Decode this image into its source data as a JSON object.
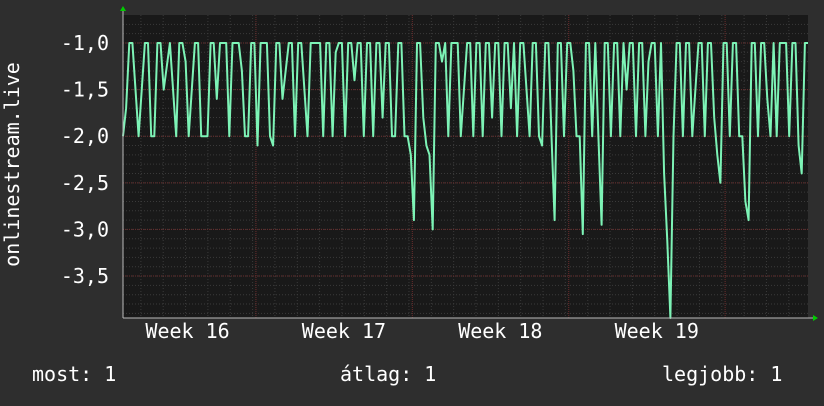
{
  "chart_data": {
    "type": "line",
    "ylabel": "onlinestream.live",
    "ylim": [
      -3.95,
      -0.7
    ],
    "y_ticks": [
      -1.0,
      -1.5,
      -2.0,
      -2.5,
      -3.0,
      -3.5
    ],
    "y_tick_labels": [
      "-1,0",
      "-1,5",
      "-2,0",
      "-2,5",
      "-3,0",
      "-3,5"
    ],
    "x_tick_labels": [
      "Week 16",
      "Week 17",
      "Week 18",
      "Week 19"
    ],
    "x_ticks_week": [
      16,
      17,
      18,
      19
    ],
    "xlim_week": [
      15.6,
      19.98
    ],
    "series": [
      {
        "color": "#7df3b6",
        "x_week": [
          15.6,
          15.62,
          15.64,
          15.66,
          15.7,
          15.74,
          15.76,
          15.78,
          15.8,
          15.82,
          15.84,
          15.86,
          15.9,
          15.94,
          15.96,
          15.98,
          16.0,
          16.02,
          16.06,
          16.08,
          16.1,
          16.14,
          16.16,
          16.18,
          16.2,
          16.22,
          16.26,
          16.28,
          16.3,
          16.34,
          16.36,
          16.38,
          16.4,
          16.42,
          16.44,
          16.46,
          16.48,
          16.5,
          16.52,
          16.54,
          16.56,
          16.58,
          16.6,
          16.62,
          16.66,
          16.68,
          16.7,
          16.72,
          16.74,
          16.78,
          16.8,
          16.82,
          16.86,
          16.88,
          16.9,
          16.92,
          16.94,
          16.96,
          16.98,
          17.0,
          17.02,
          17.04,
          17.06,
          17.08,
          17.1,
          17.12,
          17.14,
          17.16,
          17.18,
          17.2,
          17.22,
          17.24,
          17.26,
          17.28,
          17.3,
          17.32,
          17.34,
          17.36,
          17.38,
          17.4,
          17.42,
          17.44,
          17.46,
          17.48,
          17.5,
          17.52,
          17.54,
          17.56,
          17.58,
          17.6,
          17.62,
          17.64,
          17.66,
          17.68,
          17.7,
          17.72,
          17.74,
          17.76,
          17.8,
          17.82,
          17.84,
          17.86,
          17.88,
          17.9,
          17.92,
          17.94,
          17.96,
          17.98,
          18.0,
          18.02,
          18.04,
          18.06,
          18.08,
          18.1,
          18.12,
          18.14,
          18.16,
          18.18,
          18.2,
          18.22,
          18.24,
          18.26,
          18.28,
          18.3,
          18.32,
          18.34,
          18.36,
          18.38,
          18.4,
          18.42,
          18.44,
          18.46,
          18.48,
          18.5,
          18.52,
          18.54,
          18.56,
          18.58,
          18.6,
          18.62,
          18.64,
          18.66,
          18.68,
          18.7,
          18.72,
          18.74,
          18.76,
          18.78,
          18.8,
          18.82,
          18.84,
          18.86,
          18.88,
          18.9,
          18.92,
          18.94,
          18.96,
          18.98,
          19.0,
          19.02,
          19.04,
          19.06,
          19.08,
          19.1,
          19.12,
          19.14,
          19.16,
          19.18,
          19.2,
          19.22,
          19.24,
          19.26,
          19.28,
          19.3,
          19.32,
          19.34,
          19.36,
          19.38,
          19.4,
          19.42,
          19.44,
          19.46,
          19.48,
          19.5,
          19.52,
          19.54,
          19.56,
          19.58,
          19.6,
          19.62,
          19.64,
          19.66,
          19.68,
          19.7,
          19.72,
          19.74,
          19.76,
          19.78,
          19.8,
          19.82,
          19.84,
          19.86,
          19.88,
          19.9,
          19.92,
          19.94,
          19.96,
          19.98
        ],
        "values": [
          -2.0,
          -1.7,
          -1.0,
          -1.0,
          -2.0,
          -1.0,
          -1.0,
          -2.0,
          -2.0,
          -1.0,
          -1.0,
          -1.5,
          -1.0,
          -2.0,
          -1.0,
          -1.0,
          -1.2,
          -2.0,
          -1.0,
          -1.0,
          -2.0,
          -2.0,
          -1.0,
          -1.0,
          -1.6,
          -1.0,
          -1.0,
          -2.0,
          -1.0,
          -1.0,
          -1.3,
          -2.0,
          -2.0,
          -1.0,
          -1.0,
          -2.1,
          -1.0,
          -1.0,
          -1.0,
          -2.0,
          -2.1,
          -1.0,
          -1.0,
          -1.6,
          -1.0,
          -1.0,
          -2.0,
          -1.0,
          -1.0,
          -2.0,
          -1.0,
          -1.0,
          -1.0,
          -2.0,
          -1.0,
          -1.0,
          -2.0,
          -1.1,
          -1.0,
          -1.0,
          -2.0,
          -1.0,
          -1.0,
          -1.4,
          -1.0,
          -1.0,
          -2.0,
          -1.0,
          -1.0,
          -2.0,
          -1.0,
          -1.0,
          -1.8,
          -1.0,
          -1.0,
          -2.0,
          -2.0,
          -1.0,
          -1.0,
          -2.0,
          -2.0,
          -2.2,
          -2.9,
          -1.0,
          -1.0,
          -1.8,
          -2.1,
          -2.2,
          -3.0,
          -1.0,
          -1.0,
          -1.2,
          -1.0,
          -2.0,
          -1.0,
          -1.0,
          -1.0,
          -2.0,
          -1.0,
          -1.0,
          -2.0,
          -1.0,
          -1.0,
          -2.0,
          -1.0,
          -1.0,
          -1.8,
          -1.0,
          -1.0,
          -2.0,
          -1.0,
          -1.0,
          -1.7,
          -1.0,
          -2.0,
          -1.0,
          -1.0,
          -1.5,
          -2.0,
          -1.0,
          -1.0,
          -2.0,
          -2.1,
          -1.0,
          -1.0,
          -2.0,
          -2.9,
          -1.0,
          -1.0,
          -2.0,
          -1.0,
          -1.0,
          -1.3,
          -2.0,
          -2.0,
          -3.05,
          -1.0,
          -1.0,
          -2.0,
          -1.0,
          -2.0,
          -2.95,
          -1.0,
          -1.0,
          -2.0,
          -1.0,
          -1.0,
          -2.0,
          -1.0,
          -1.5,
          -1.0,
          -1.0,
          -2.0,
          -1.0,
          -1.0,
          -2.0,
          -1.2,
          -1.0,
          -1.0,
          -2.0,
          -1.0,
          -2.4,
          -3.1,
          -3.95,
          -2.0,
          -1.0,
          -1.0,
          -2.0,
          -1.0,
          -1.0,
          -2.0,
          -1.5,
          -1.0,
          -1.0,
          -2.0,
          -1.0,
          -1.0,
          -1.8,
          -2.2,
          -2.5,
          -1.0,
          -1.0,
          -2.0,
          -1.0,
          -1.0,
          -2.0,
          -2.0,
          -2.7,
          -2.9,
          -1.0,
          -1.0,
          -2.0,
          -1.0,
          -1.0,
          -1.6,
          -2.0,
          -1.0,
          -2.0,
          -1.0,
          -1.0,
          -1.0,
          -2.0,
          -1.0,
          -1.0,
          -2.1,
          -2.4,
          -1.0,
          -1.0
        ]
      }
    ],
    "colors": {
      "background": "#2e2e2e",
      "plot_background": "#191919",
      "line": "#7df3b6",
      "grid_minor": "#3a3a3a",
      "grid_major": "#6b2d2d",
      "axis_arrow": "#00cc00"
    },
    "grid": true,
    "legend": {
      "now_label": "most: 1",
      "avg_label": "átlag: 1",
      "max_label": "legjobb: 1"
    }
  }
}
